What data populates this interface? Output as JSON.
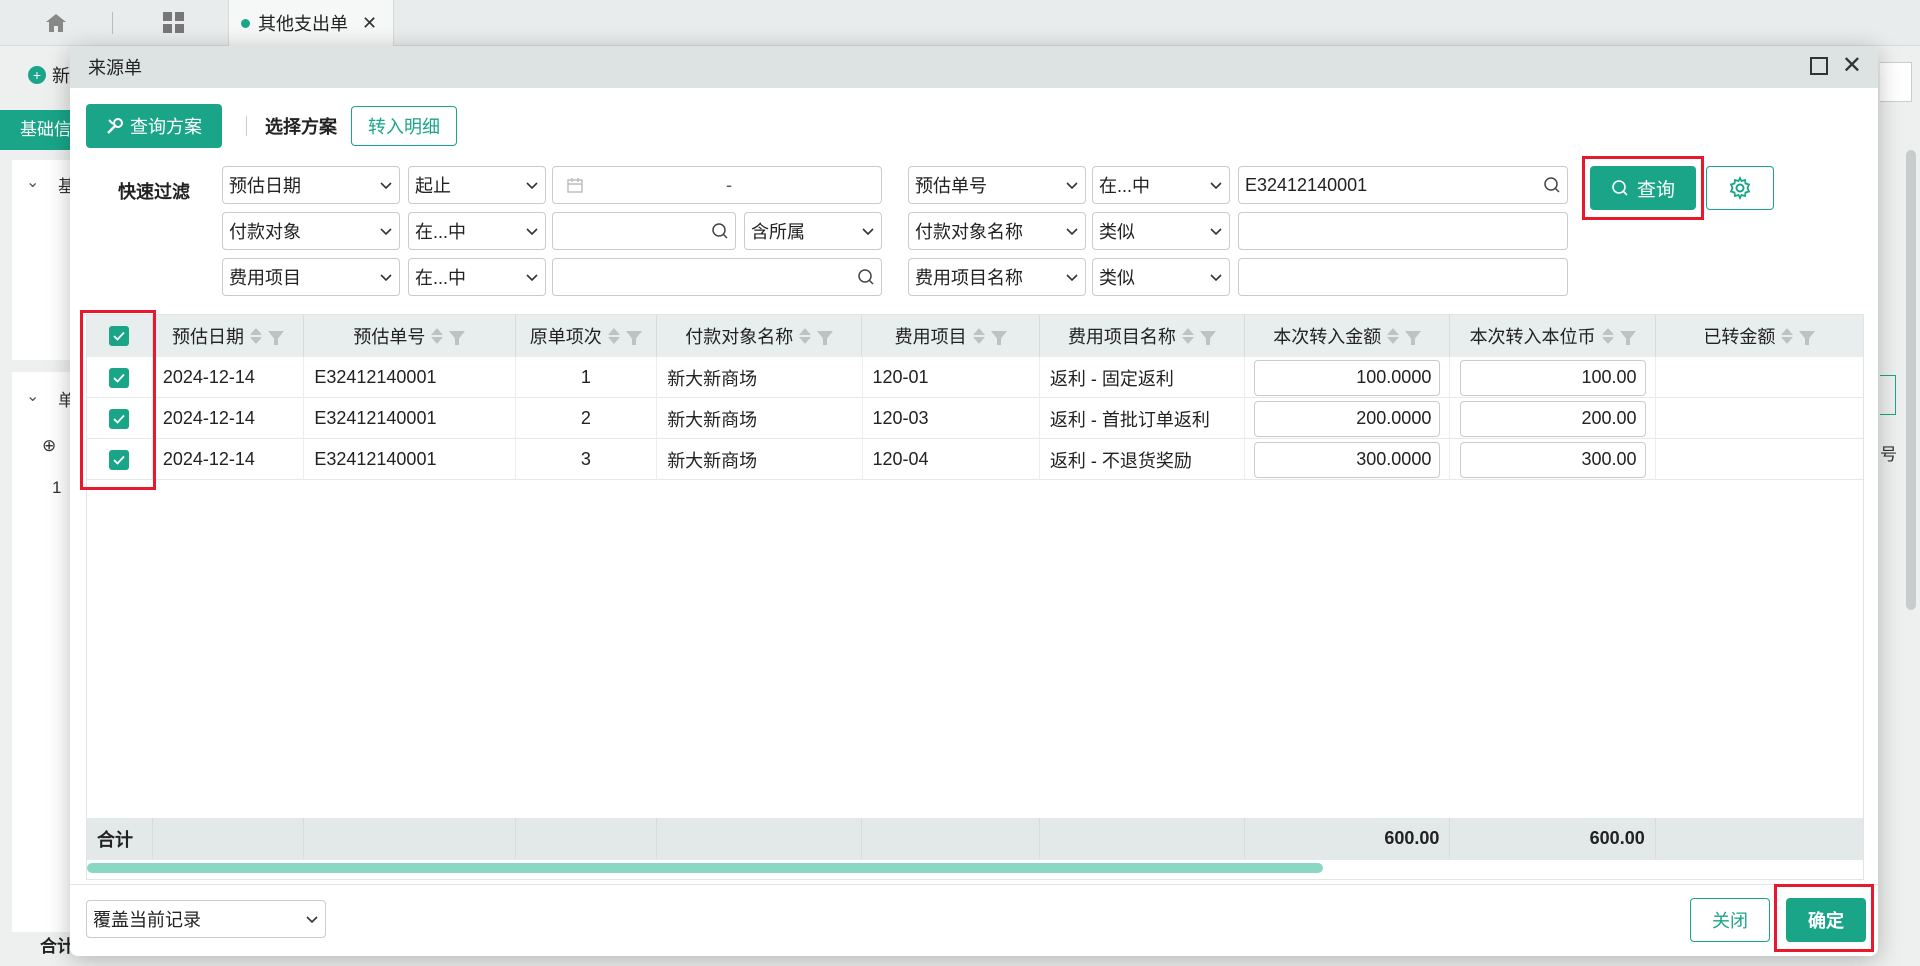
{
  "app": {
    "tab_label": "其他支出单",
    "new_label": "新",
    "bg_tab_label": "基础信",
    "bg_section_1": "基",
    "bg_section_2": "单",
    "bg_row_no": "1",
    "bg_total_label": "合计",
    "bg_right_text": "号"
  },
  "modal": {
    "title": "来源单",
    "toolbar": {
      "query_scheme_label": "查询方案",
      "select_scheme_label": "选择方案",
      "transfer_detail_label": "转入明细"
    },
    "filter": {
      "label": "快速过滤",
      "rows": [
        {
          "field": "预估日期",
          "op": "起止",
          "value": "-",
          "field2": "预估单号",
          "op2": "在...中",
          "value2": "E32412140001"
        },
        {
          "field": "付款对象",
          "op": "在...中",
          "value": "",
          "extra": "含所属",
          "field2": "付款对象名称",
          "op2": "类似",
          "value2": ""
        },
        {
          "field": "费用项目",
          "op": "在...中",
          "value": "",
          "field2": "费用项目名称",
          "op2": "类似",
          "value2": ""
        }
      ],
      "query_button": "查询"
    },
    "table": {
      "columns": [
        "预估日期",
        "预估单号",
        "原单项次",
        "付款对象名称",
        "费用项目",
        "费用项目名称",
        "本次转入金额",
        "本次转入本位币",
        "已转金额"
      ],
      "rows": [
        {
          "date": "2024-12-14",
          "order_no": "E32412140001",
          "line": "1",
          "payee": "新大新商场",
          "item": "120-01",
          "item_name": "返利 - 固定返利",
          "amount": "100.0000",
          "base_amount": "100.00",
          "transferred": ""
        },
        {
          "date": "2024-12-14",
          "order_no": "E32412140001",
          "line": "2",
          "payee": "新大新商场",
          "item": "120-03",
          "item_name": "返利 - 首批订单返利",
          "amount": "200.0000",
          "base_amount": "200.00",
          "transferred": ""
        },
        {
          "date": "2024-12-14",
          "order_no": "E32412140001",
          "line": "3",
          "payee": "新大新商场",
          "item": "120-04",
          "item_name": "返利 - 不退货奖励",
          "amount": "300.0000",
          "base_amount": "300.00",
          "transferred": ""
        }
      ],
      "footer": {
        "label": "合计",
        "amount_total": "600.00",
        "base_total": "600.00"
      }
    },
    "footer": {
      "mode_select": "覆盖当前记录",
      "close_label": "关闭",
      "ok_label": "确定"
    }
  },
  "colors": {
    "accent": "#1aa588",
    "highlight": "#e8192c"
  }
}
